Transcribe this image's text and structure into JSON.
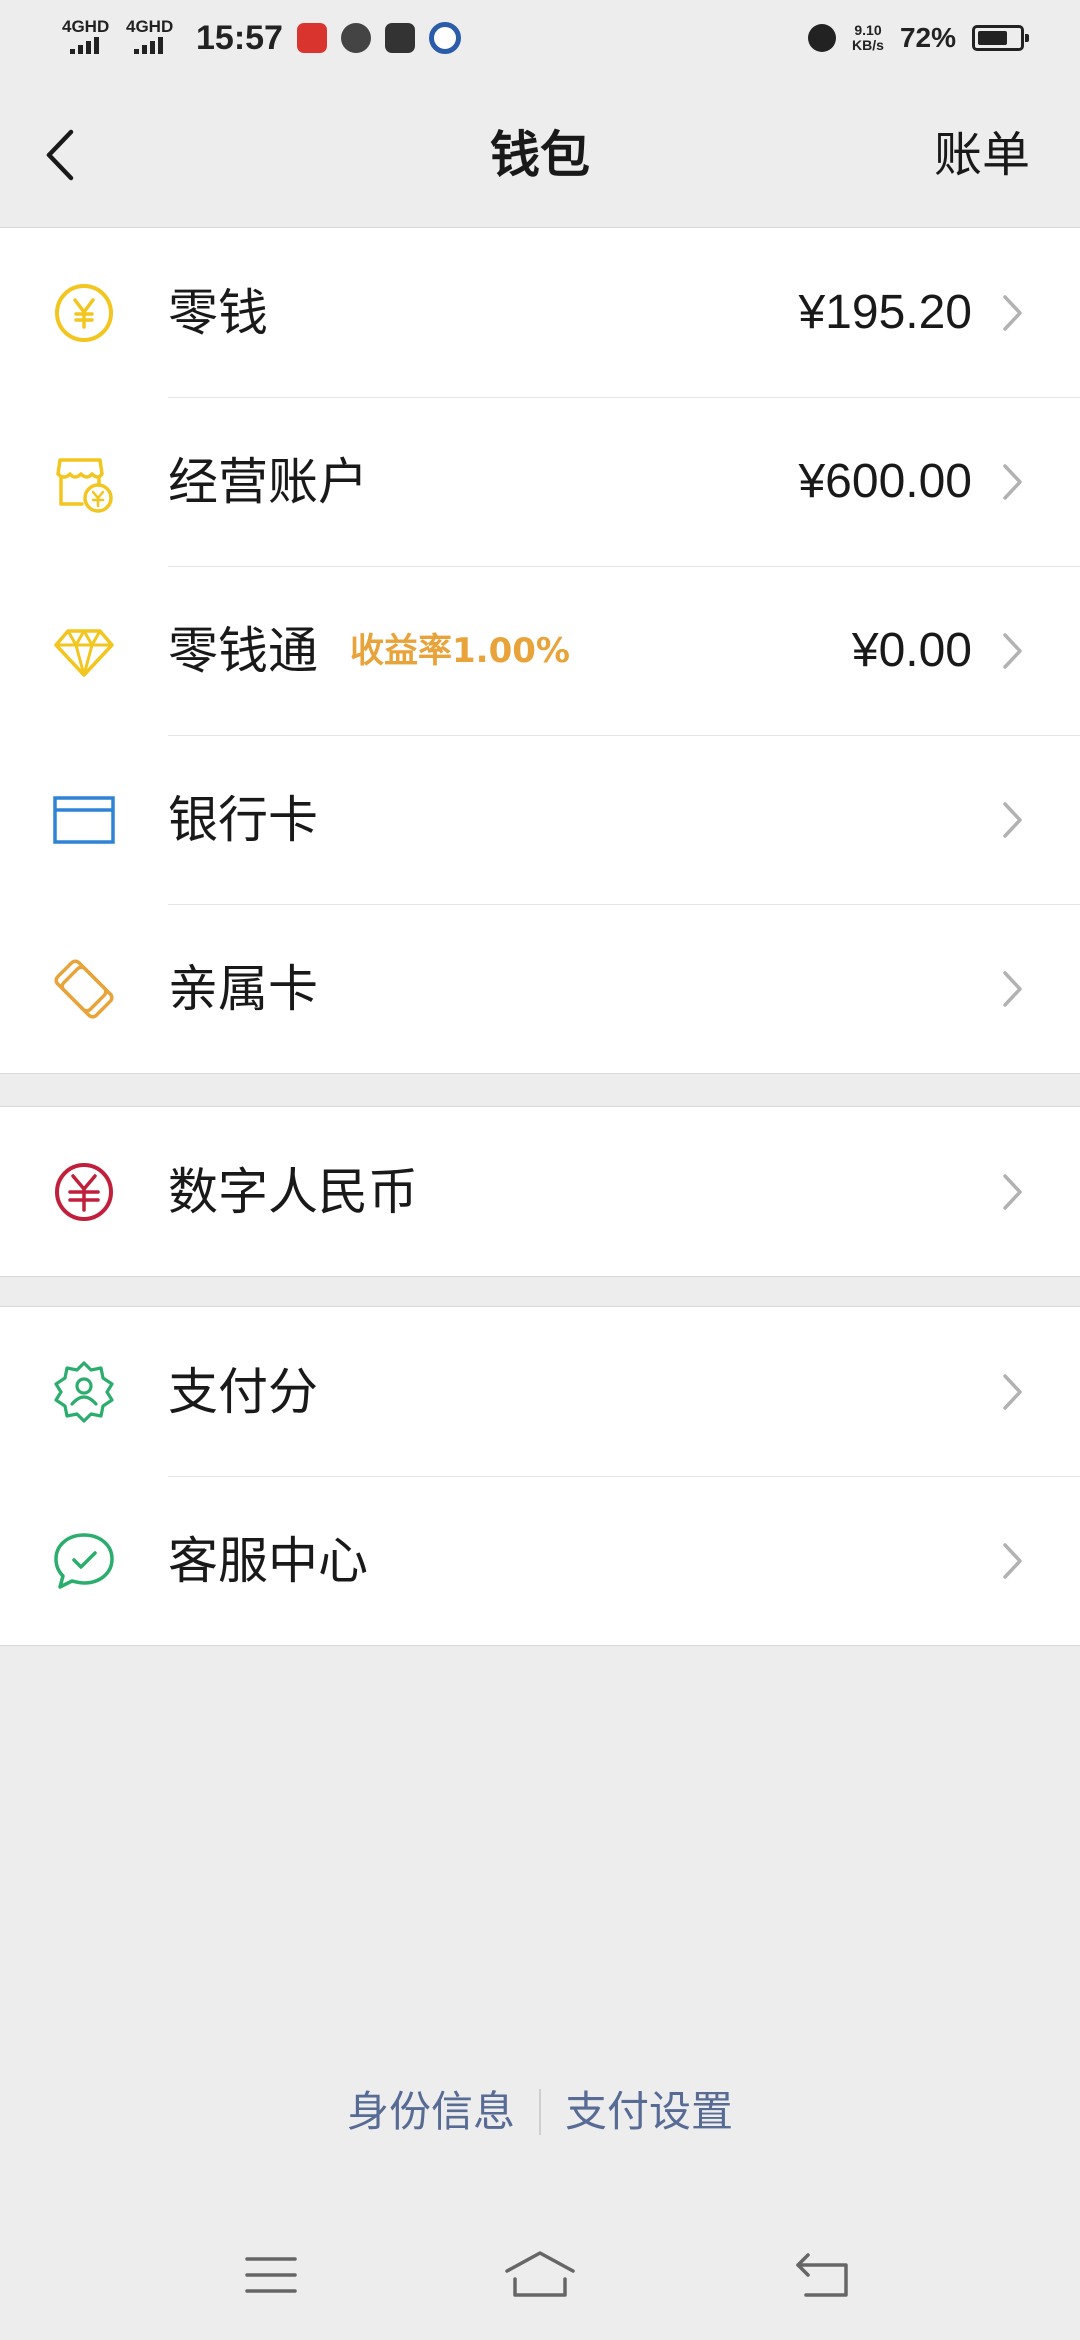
{
  "status_bar": {
    "net1": "4GHD",
    "net2": "4GHD",
    "time": "15:57",
    "speed_value": "9.10",
    "speed_unit": "KB/s",
    "battery_pct": "72%",
    "battery_level": 0.72,
    "icons": [
      "toutiao-app-icon",
      "weather-cloud-icon",
      "mail-app-icon",
      "baidu-app-icon",
      "alarm-icon",
      "battery-icon"
    ]
  },
  "nav": {
    "back_icon": "chevron-left-icon",
    "title": "钱包",
    "action": "账单"
  },
  "colors": {
    "background": "#ededed",
    "card": "#ffffff",
    "yellow": "#f2c61f",
    "blue": "#2f83d3",
    "orange": "#e8a33b",
    "red": "#c1203c",
    "green": "#2bad6d",
    "link": "#576b95",
    "chevron": "#b2b2b2"
  },
  "groups": [
    {
      "items": [
        {
          "icon": "yuan-coin-icon",
          "label": "零钱",
          "value": "¥195.20"
        },
        {
          "icon": "shop-account-icon",
          "label": "经营账户",
          "value": "¥600.00"
        },
        {
          "icon": "diamond-icon",
          "label": "零钱通",
          "badge": "收益率1.00%",
          "value": "¥0.00"
        },
        {
          "icon": "bank-card-icon",
          "label": "银行卡",
          "value": ""
        },
        {
          "icon": "family-card-icon",
          "label": "亲属卡",
          "value": ""
        }
      ]
    },
    {
      "items": [
        {
          "icon": "digital-rmb-icon",
          "label": "数字人民币",
          "value": ""
        }
      ]
    },
    {
      "items": [
        {
          "icon": "pay-score-icon",
          "label": "支付分",
          "value": ""
        },
        {
          "icon": "customer-service-icon",
          "label": "客服中心",
          "value": ""
        }
      ]
    }
  ],
  "footer": {
    "link1": "身份信息",
    "link2": "支付设置"
  },
  "system_nav": {
    "icons": [
      "menu-icon",
      "home-icon",
      "back-icon"
    ]
  }
}
